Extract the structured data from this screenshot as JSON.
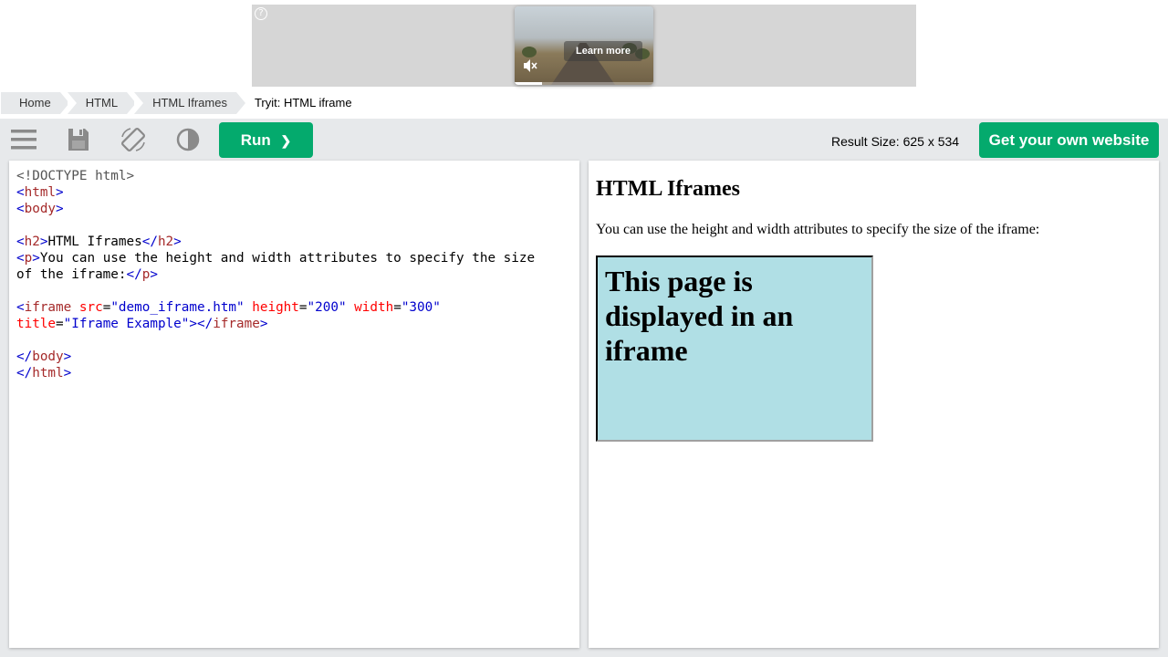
{
  "ad": {
    "info_glyph": "?",
    "learn_more": "Learn more",
    "progress_fraction": 0.2
  },
  "breadcrumb": {
    "items": [
      "Home",
      "HTML",
      "HTML Iframes"
    ],
    "current": "Tryit: HTML iframe"
  },
  "toolbar": {
    "icons": [
      "menu-icon",
      "save-icon",
      "rotate-icon",
      "contrast-icon"
    ],
    "run_label": "Run",
    "run_chevron": "❯",
    "result_size": "Result Size: 625 x 534",
    "own_website_label": "Get your own website"
  },
  "code": {
    "doctype": "<!DOCTYPE html>",
    "html_tag": "html",
    "body_tag": "body",
    "h2_tag": "h2",
    "h2_text": "HTML Iframes",
    "p_tag": "p",
    "p_text_line1": "You can use the height and width attributes to specify the size",
    "p_text_line2": "of the iframe:",
    "iframe_tag": "iframe",
    "attr_src": "src",
    "val_src": "\"demo_iframe.htm\"",
    "attr_height": "height",
    "val_height": "\"200\"",
    "attr_width": "width",
    "val_width": "\"300\"",
    "attr_title": "title",
    "val_title": "\"Iframe Example\""
  },
  "result": {
    "heading": "HTML Iframes",
    "paragraph": "You can use the height and width attributes to specify the size of the iframe:",
    "iframe_heading": "This page is displayed in an iframe"
  },
  "colors": {
    "accent_green": "#04aa6d",
    "iframe_bg": "#b0dfe5",
    "workspace_bg": "#e7e9eb"
  }
}
